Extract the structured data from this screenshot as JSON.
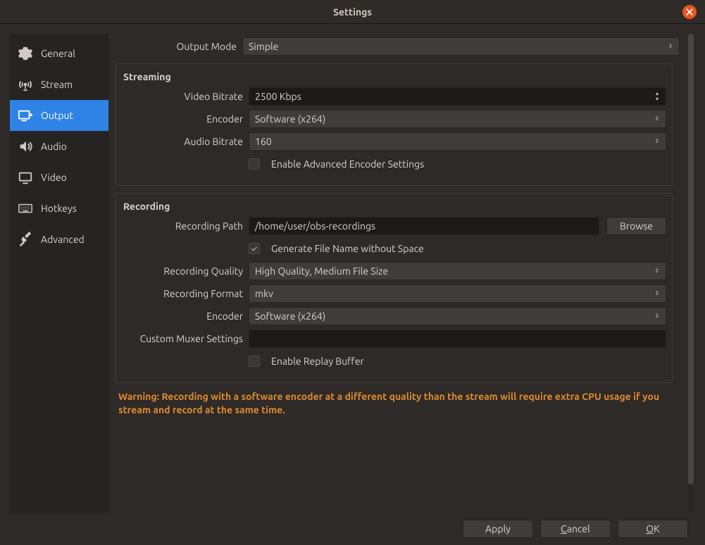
{
  "window": {
    "title": "Settings"
  },
  "sidebar": {
    "items": [
      {
        "label": "General"
      },
      {
        "label": "Stream"
      },
      {
        "label": "Output"
      },
      {
        "label": "Audio"
      },
      {
        "label": "Video"
      },
      {
        "label": "Hotkeys"
      },
      {
        "label": "Advanced"
      }
    ],
    "selected_index": 2
  },
  "output_mode": {
    "label": "Output Mode",
    "value": "Simple"
  },
  "streaming": {
    "title": "Streaming",
    "video_bitrate_label": "Video Bitrate",
    "video_bitrate_value": "2500 Kbps",
    "encoder_label": "Encoder",
    "encoder_value": "Software (x264)",
    "audio_bitrate_label": "Audio Bitrate",
    "audio_bitrate_value": "160",
    "advanced_checkbox_label": "Enable Advanced Encoder Settings",
    "advanced_checked": false
  },
  "recording": {
    "title": "Recording",
    "path_label": "Recording Path",
    "path_value": "/home/user/obs-recordings",
    "browse_label": "Browse",
    "genfile_label": "Generate File Name without Space",
    "genfile_checked": true,
    "quality_label": "Recording Quality",
    "quality_value": "High Quality, Medium File Size",
    "format_label": "Recording Format",
    "format_value": "mkv",
    "encoder_label": "Encoder",
    "encoder_value": "Software (x264)",
    "muxer_label": "Custom Muxer Settings",
    "muxer_value": "",
    "replay_label": "Enable Replay Buffer",
    "replay_checked": false
  },
  "warning": "Warning: Recording with a software encoder at a different quality than the stream will require extra CPU usage if you stream and record at the same time.",
  "footer": {
    "apply": "Apply",
    "cancel": "Cancel",
    "ok": "OK"
  }
}
